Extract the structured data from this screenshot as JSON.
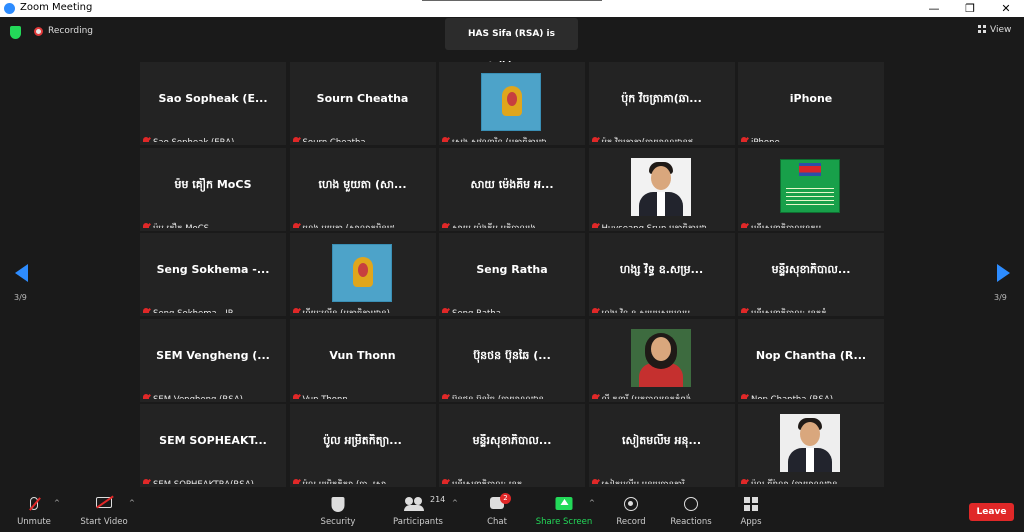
{
  "window": {
    "title": "Zoom Meeting",
    "controls": {
      "minimize": "—",
      "restore": "❐",
      "close": "✕"
    }
  },
  "status": {
    "recording_label": "Recording",
    "talking": "HAS Sifa (RSA) is talking...",
    "view_label": "View"
  },
  "pager": {
    "left": "3/9",
    "right": "3/9"
  },
  "tiles": [
    {
      "display": "Sao  Sopheak  (E...",
      "name": "Sao Sopheak (ERA)",
      "media": "text"
    },
    {
      "display": "Sourn Cheatha",
      "name": "Sourn Cheatha",
      "media": "text"
    },
    {
      "display": "",
      "name": "សេង សុវណ្ណារិទ្ធ (អគ្គាធិការដ្ឋា...",
      "media": "logo"
    },
    {
      "display": "ប៉ុក វិចត្រាភា(ឆា...",
      "name": "ប៉ុក វិចត្រាភា(ឆាយាណដ្ឋានឥ...",
      "media": "text"
    },
    {
      "display": "iPhone",
      "name": "iPhone",
      "media": "text"
    },
    {
      "display": "ម៉ម គឿក MoCS",
      "name": "ម៉ម គឿក MoCS",
      "media": "text"
    },
    {
      "display": "ហេង មួយតា (សា...",
      "name": "ហេង មួយតា (សាលាភូមិន្ទរដ្ឋ...",
      "media": "text"
    },
    {
      "display": "សាយ ម៉េងគីម អ...",
      "name": "សាយ ម៉េងគីម អភិបាលរង...",
      "media": "text"
    },
    {
      "display": "",
      "name": "Huyseang Srun អគ្គាធិការដ្ឋា...",
      "media": "photo"
    },
    {
      "display": "",
      "name": "មន្ទីរសុខាភិបាលខេត្តប...",
      "media": "flag"
    },
    {
      "display": "Seng  Sokhema  -...",
      "name": "Seng Sokhema - IR",
      "media": "text"
    },
    {
      "display": "",
      "name": "ហ៊ីយៈលើន (អគ្គាធិការដ្ឋាន)",
      "media": "logo"
    },
    {
      "display": "Seng Ratha",
      "name": "Seng Ratha",
      "media": "text"
    },
    {
      "display": "ហង្ស វិទ្ធ ឧ.សម្រ...",
      "name": "ហង្ស វិទ្ធ ឧ.សម្របសម្រួលអ...",
      "media": "text"
    },
    {
      "display": "មន្ទីរសុខាភិបាល...",
      "name": "មន្ទីរសុខាភិបាល: ខេត្តកំ...",
      "media": "text"
    },
    {
      "display": "SEM  Vengheng  (...",
      "name": "SEM Vengheng (RSA)",
      "media": "text"
    },
    {
      "display": "Vun Thonn",
      "name": "Vun Thonn",
      "media": "text"
    },
    {
      "display": "ប៊ុនថន ប៊ុនឆៃ (...",
      "name": "ប៊ុនថន ប៊ុនឆៃ (ឆាយាណដ្ឋាន...",
      "media": "text"
    },
    {
      "display": "",
      "name": "លី គន្ធារី (អ្នកបាលខេត្តកំពង់...",
      "media": "photo-woman"
    },
    {
      "display": "Nop  Chantha  (R...",
      "name": "Nop Chantha (RSA)",
      "media": "text"
    },
    {
      "display": "SEM  SOPHEAKT...",
      "name": "SEM SOPHEAKTRA(RSA)",
      "media": "text"
    },
    {
      "display": "ប៉ូល អម្រិតកិត្យា...",
      "name": "ប៉ូល អម្រិតកិត្យា (ឆា. សោ...",
      "media": "text"
    },
    {
      "display": "មន្ទីរសុខាភិបាល...",
      "name": "មន្ទីរសុខាភិបាល: ខេត្ត...",
      "media": "text"
    },
    {
      "display": "សៀតមលីម អនុ...",
      "name": "សៀតមលីម អនុប្រធានការិ...",
      "media": "text"
    },
    {
      "display": "",
      "name": "ប៉ូល ធីរ៉ាល្លា (ឆាយាណដ្ឋាន...",
      "media": "photo-man2"
    }
  ],
  "toolbar": {
    "unmute": "Unmute",
    "start_video": "Start Video",
    "security": "Security",
    "participants": "Participants",
    "participants_count": "214",
    "chat": "Chat",
    "chat_badge": "2",
    "share_screen": "Share Screen",
    "record": "Record",
    "reactions": "Reactions",
    "apps": "Apps",
    "leave": "Leave",
    "caret": "^"
  },
  "colors": {
    "accent_blue": "#2d8cff",
    "share_green": "#23d959",
    "leave_red": "#e02828",
    "background": "#1a1a1a",
    "tile": "#232323"
  }
}
